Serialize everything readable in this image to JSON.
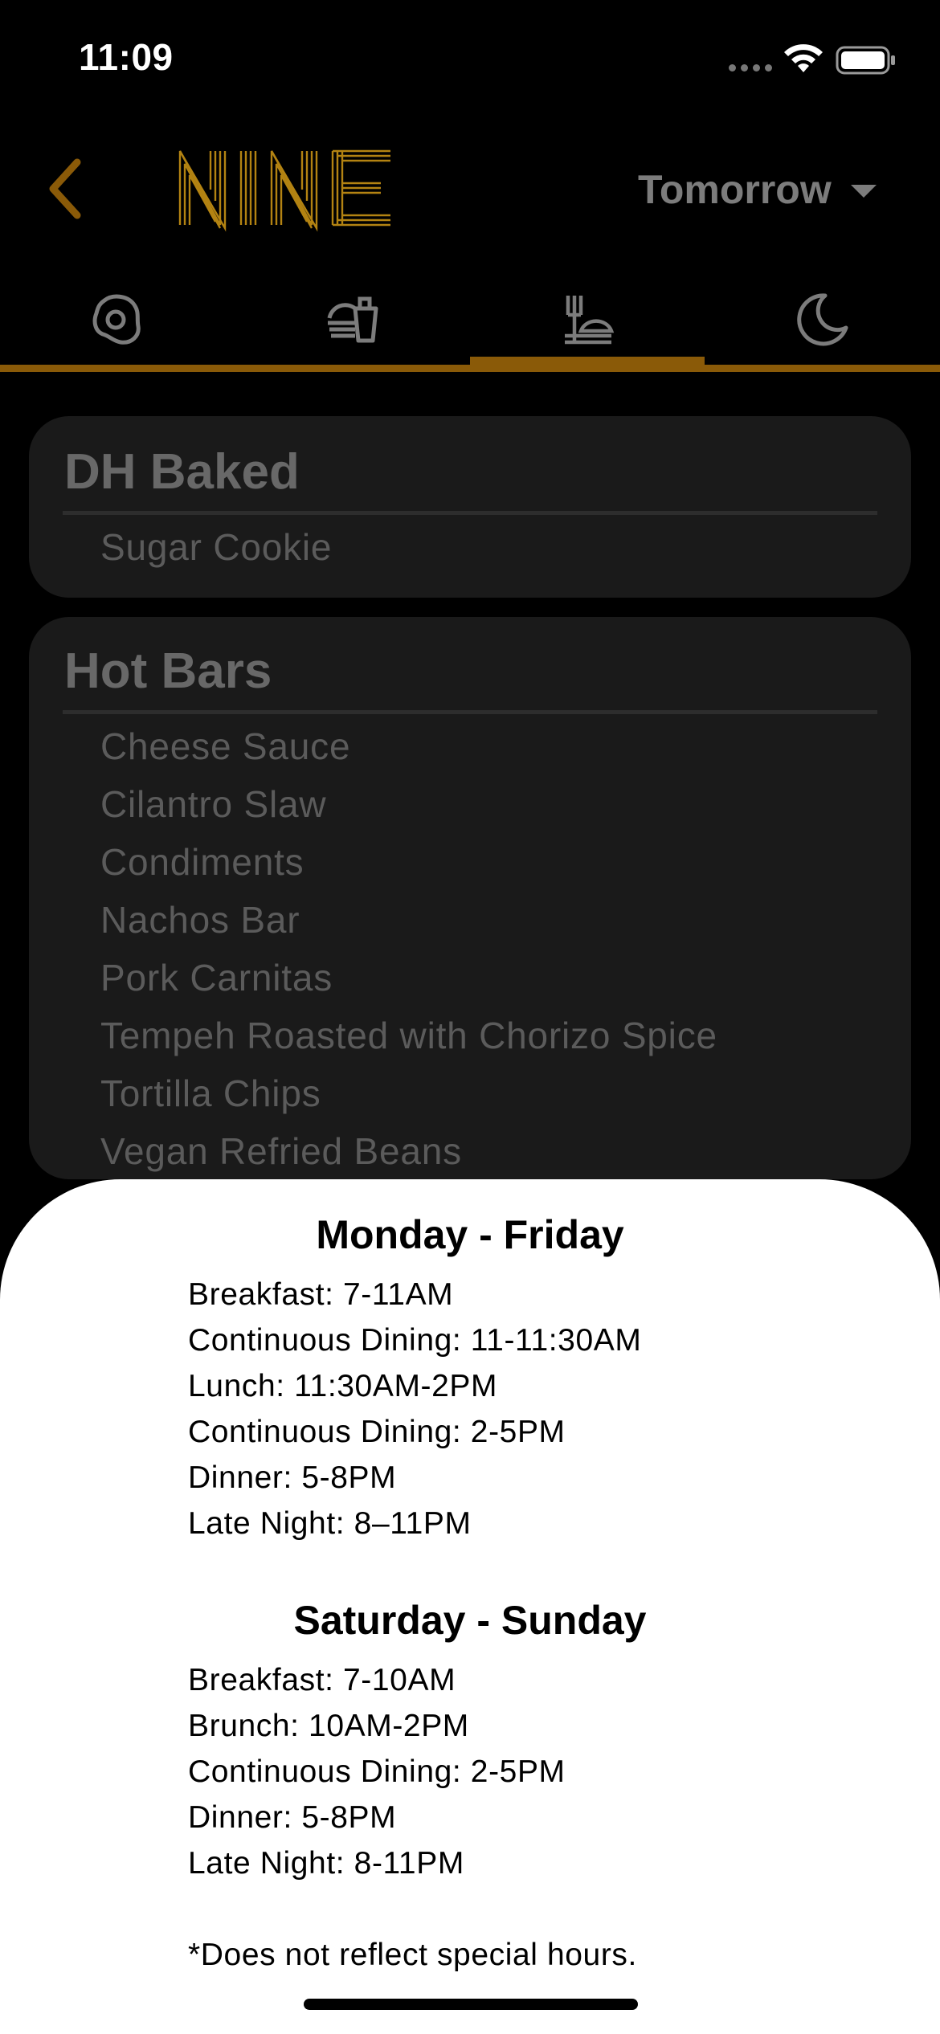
{
  "status_bar": {
    "time": "11:09",
    "icons": [
      "signal-dots-icon",
      "wifi-icon",
      "battery-icon"
    ]
  },
  "nav": {
    "back_icon": "chevron-left-icon",
    "logo_text": "NINE",
    "date_selector": "Tomorrow",
    "date_icon": "caret-down-icon"
  },
  "tabs": [
    {
      "icon": "egg-icon",
      "meal": "Breakfast",
      "active": false
    },
    {
      "icon": "takeout-icon",
      "meal": "Lunch",
      "active": false
    },
    {
      "icon": "dining-icon",
      "meal": "Dinner",
      "active": true
    },
    {
      "icon": "moon-icon",
      "meal": "Late Night",
      "active": false
    }
  ],
  "colors": {
    "accent": "#8a5a08",
    "logo": "#b38312",
    "background": "#000000",
    "card": "#1a1a1a",
    "sheet": "#ffffff"
  },
  "stations": [
    {
      "title": "DH Baked",
      "items": [
        "Sugar Cookie"
      ]
    },
    {
      "title": "Hot Bars",
      "items": [
        "Cheese Sauce",
        "Cilantro Slaw",
        "Condiments",
        "Nachos Bar",
        "Pork Carnitas",
        "Tempeh Roasted with Chorizo Spice",
        "Tortilla Chips",
        "Vegan Refried Beans"
      ]
    }
  ],
  "hours": {
    "weekday_heading": "Monday - Friday",
    "weekday": [
      "Breakfast: 7-11AM",
      "Continuous Dining: 11-11:30AM",
      "Lunch: 11:30AM-2PM",
      "Continuous Dining: 2-5PM",
      "Dinner: 5-8PM",
      "Late Night: 8–11PM"
    ],
    "weekend_heading": "Saturday - Sunday",
    "weekend": [
      "Breakfast: 7-10AM",
      "Brunch: 10AM-2PM",
      "Continuous Dining: 2-5PM",
      "Dinner: 5-8PM",
      "Late Night: 8-11PM"
    ],
    "footnote": "*Does not reflect special hours."
  }
}
